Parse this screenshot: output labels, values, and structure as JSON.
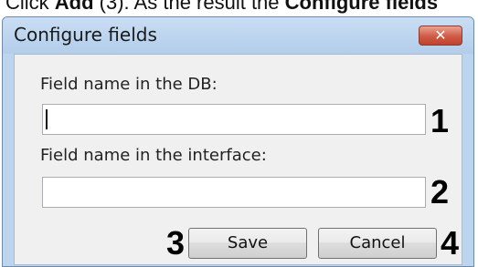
{
  "page": {
    "caption_prefix": "Click ",
    "caption_add": "Add",
    "caption_middle": " (3). As the result the ",
    "caption_configure": "Configure fields"
  },
  "dialog": {
    "title": "Configure fields",
    "close_symbol": "✕",
    "db_field_label": "Field name in the DB:",
    "db_field_value": "",
    "interface_field_label": "Field name in the interface:",
    "interface_field_value": "",
    "save_label": "Save",
    "cancel_label": "Cancel"
  },
  "callouts": {
    "db_field": "1",
    "interface_field": "2",
    "save_button": "3",
    "cancel_button": "4"
  }
}
